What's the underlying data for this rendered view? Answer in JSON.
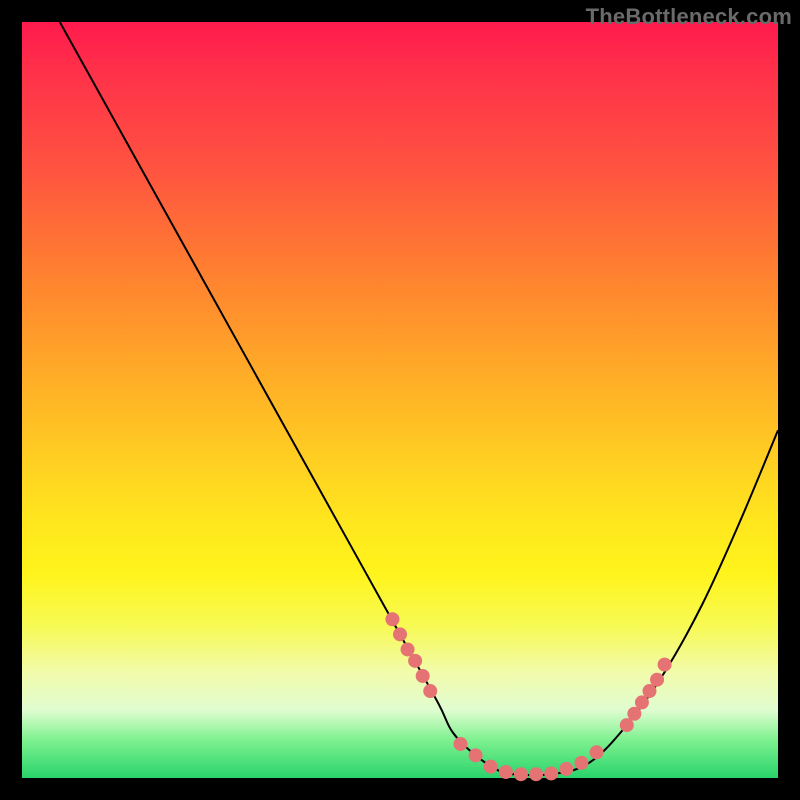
{
  "watermark": "TheBottleneck.com",
  "chart_data": {
    "type": "line",
    "title": "",
    "xlabel": "",
    "ylabel": "",
    "xlim": [
      0,
      100
    ],
    "ylim": [
      0,
      100
    ],
    "grid": false,
    "series": [
      {
        "name": "curve",
        "color": "#000000",
        "x": [
          5,
          10,
          15,
          20,
          25,
          30,
          35,
          40,
          45,
          50,
          55,
          57,
          60,
          63,
          65,
          70,
          75,
          80,
          85,
          90,
          95,
          100
        ],
        "y": [
          100,
          91,
          82,
          73,
          64,
          55,
          46,
          37,
          28,
          19,
          10,
          6,
          3,
          1,
          0.5,
          0.5,
          2,
          7,
          14,
          23,
          34,
          46
        ]
      }
    ],
    "markers": [
      {
        "name": "left-cluster",
        "color": "#e57373",
        "radius_px": 7,
        "points": [
          {
            "x": 49,
            "y": 21
          },
          {
            "x": 50,
            "y": 19
          },
          {
            "x": 51,
            "y": 17
          },
          {
            "x": 52,
            "y": 15.5
          },
          {
            "x": 53,
            "y": 13.5
          },
          {
            "x": 54,
            "y": 11.5
          }
        ]
      },
      {
        "name": "bottom-cluster",
        "color": "#e57373",
        "radius_px": 7,
        "points": [
          {
            "x": 58,
            "y": 4.5
          },
          {
            "x": 60,
            "y": 3
          },
          {
            "x": 62,
            "y": 1.5
          },
          {
            "x": 64,
            "y": 0.8
          },
          {
            "x": 66,
            "y": 0.5
          },
          {
            "x": 68,
            "y": 0.5
          },
          {
            "x": 70,
            "y": 0.6
          },
          {
            "x": 72,
            "y": 1.2
          },
          {
            "x": 74,
            "y": 2
          },
          {
            "x": 76,
            "y": 3.4
          }
        ]
      },
      {
        "name": "right-cluster",
        "color": "#e57373",
        "radius_px": 7,
        "points": [
          {
            "x": 80,
            "y": 7
          },
          {
            "x": 81,
            "y": 8.5
          },
          {
            "x": 82,
            "y": 10
          },
          {
            "x": 83,
            "y": 11.5
          },
          {
            "x": 84,
            "y": 13
          },
          {
            "x": 85,
            "y": 15
          }
        ]
      }
    ]
  }
}
